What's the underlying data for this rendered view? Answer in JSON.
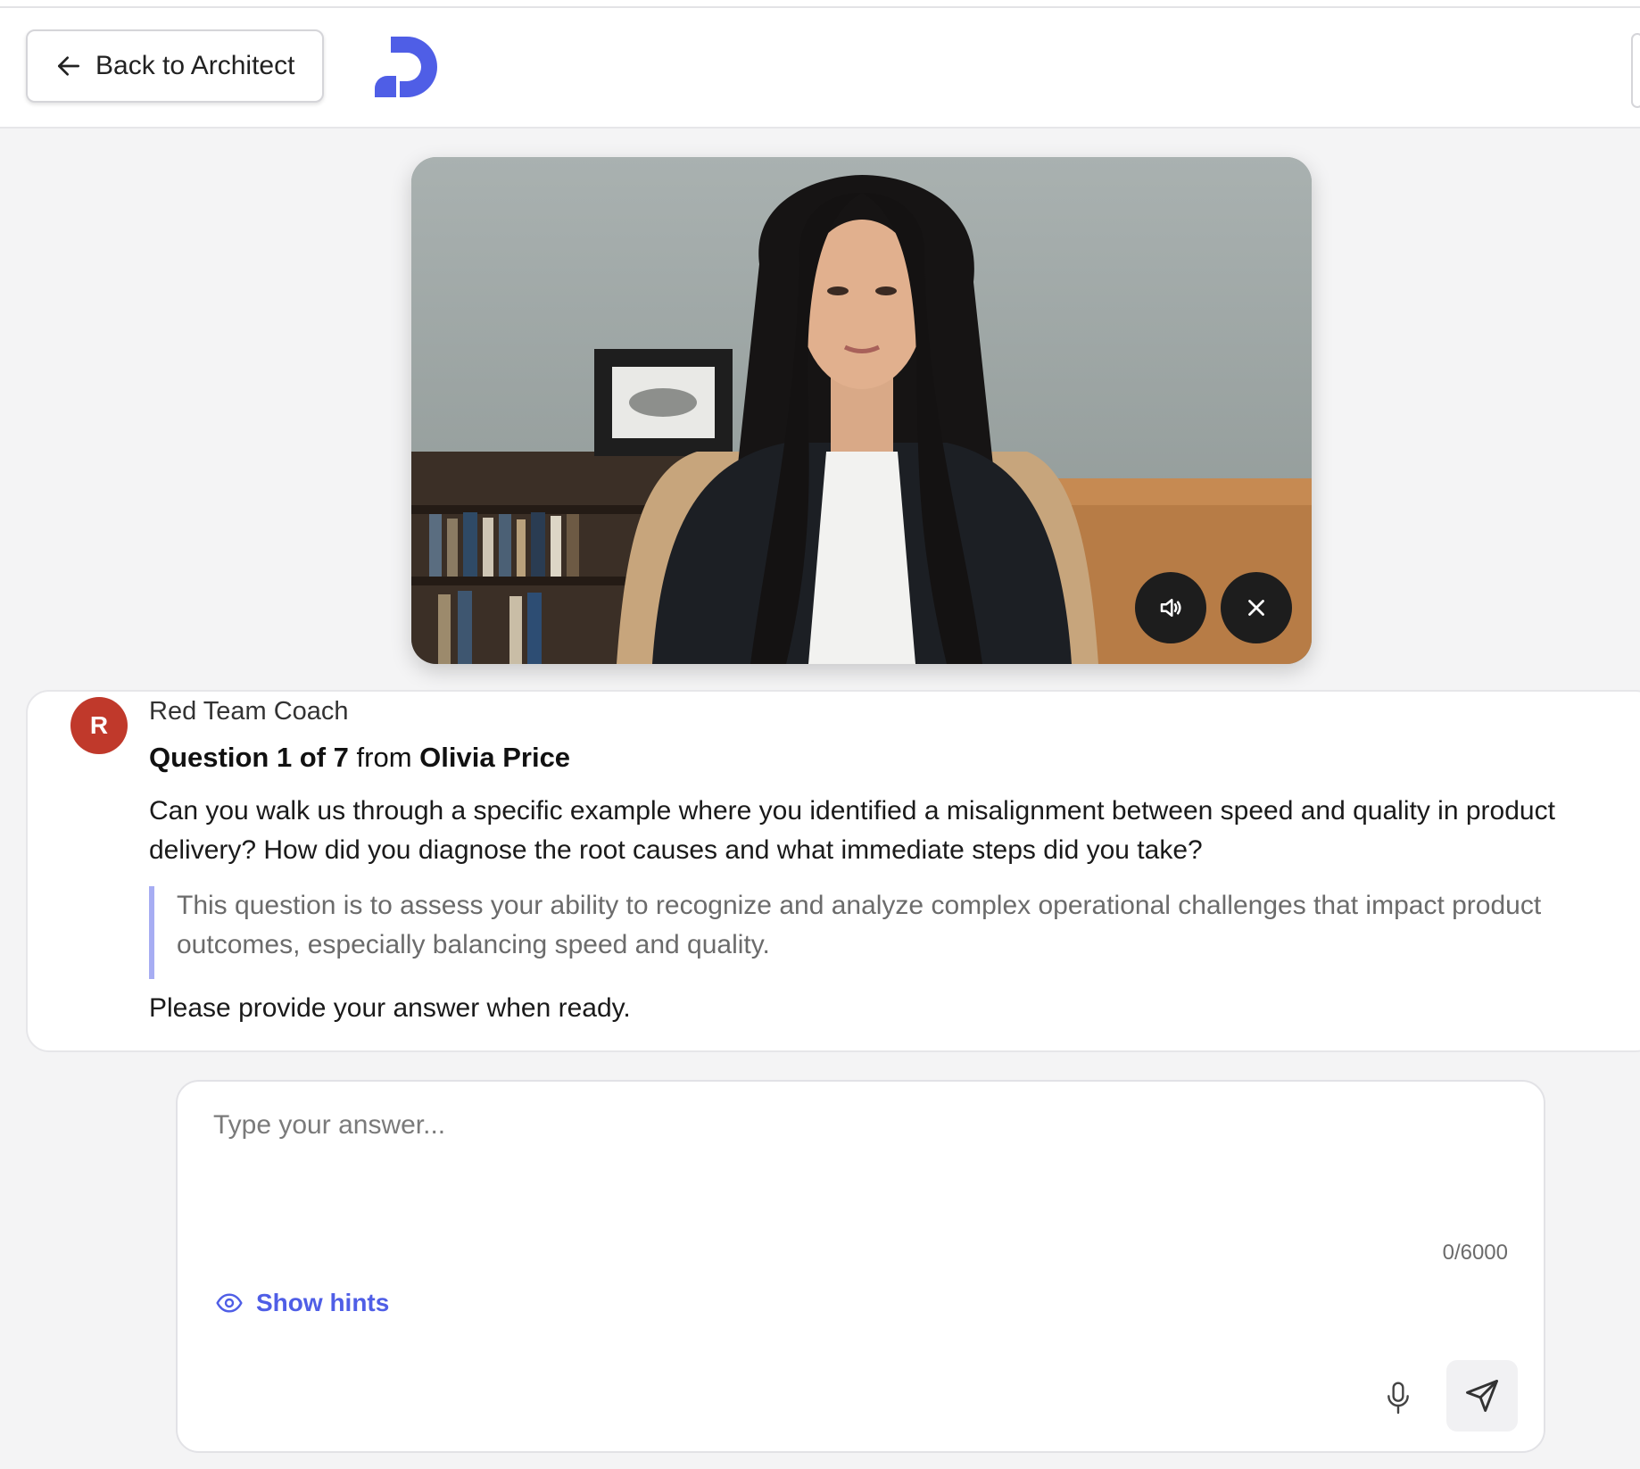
{
  "header": {
    "back_label": "Back to Architect"
  },
  "video": {
    "speaker_icon": "speaker-icon",
    "close_icon": "close-icon"
  },
  "message": {
    "avatar_initial": "R",
    "sender": "Red Team Coach",
    "question_label": "Question 1 of 7",
    "from_word": "from",
    "interviewer": "Olivia Price",
    "question_text": "Can you walk us through a specific example where you identified a misalignment between speed and quality in product delivery? How did you diagnose the root causes and what immediate steps did you take?",
    "context_note": "This question is to assess your ability to recognize and analyze complex operational challenges that impact product outcomes, especially balancing speed and quality.",
    "prompt": "Please provide your answer when ready."
  },
  "answer": {
    "placeholder": "Type your answer...",
    "counter": "0/6000",
    "hints_label": "Show hints"
  },
  "colors": {
    "accent": "#4f5ee6",
    "avatar": "#c0392b",
    "quote_border": "#a7adf3"
  }
}
